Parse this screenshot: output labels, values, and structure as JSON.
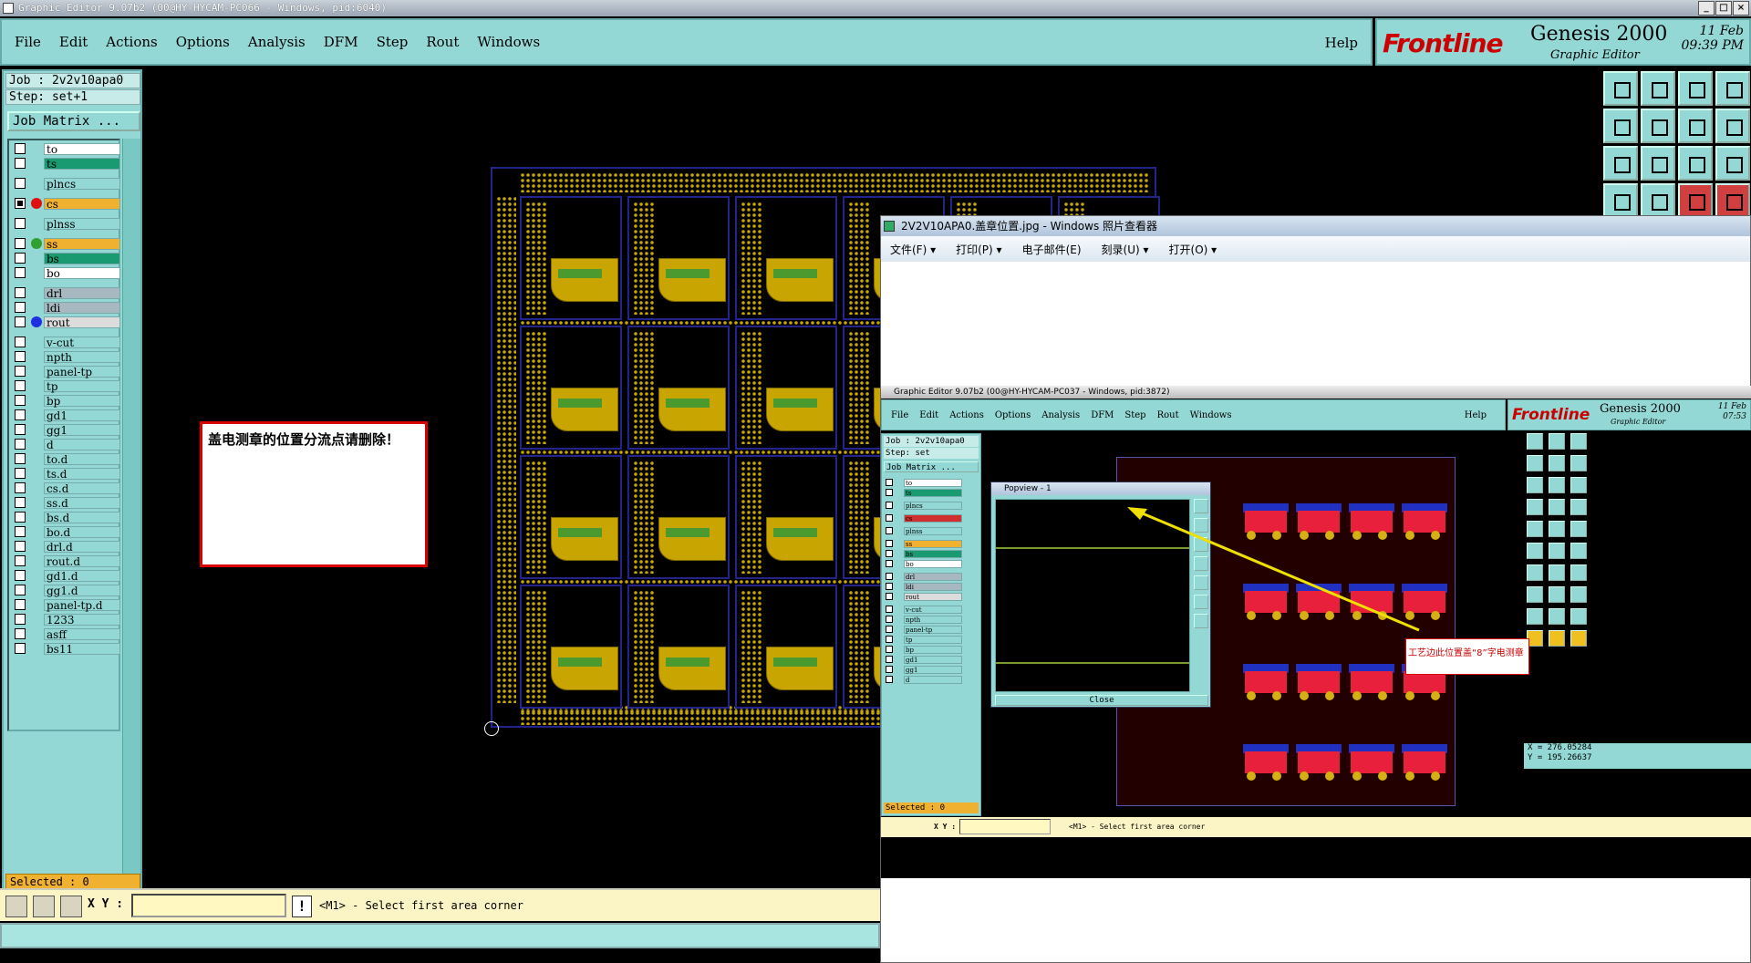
{
  "window": {
    "title": "Graphic Editor 9.07b2 (00@HY-HYCAM-PC066 - Windows, pid:6040)"
  },
  "menu": [
    "File",
    "Edit",
    "Actions",
    "Options",
    "Analysis",
    "DFM",
    "Step",
    "Rout",
    "Windows"
  ],
  "help_label": "Help",
  "brand": {
    "logo": "Frontline",
    "product": "Genesis 2000",
    "subtitle": "Graphic Editor",
    "date": "11 Feb",
    "time": "09:39 PM"
  },
  "job": {
    "job_line": "Job : 2v2v10apa0",
    "step_line": "Step: set+1",
    "matrix_button": "Job Matrix ..."
  },
  "layers": [
    {
      "name": "to",
      "color": "#ffffff",
      "dot": ""
    },
    {
      "name": "ts",
      "color": "#1a9a70",
      "dot": ""
    },
    {
      "name": "plncs",
      "color": "#93d8d4",
      "dot": ""
    },
    {
      "name": "cs",
      "color": "#f0b030",
      "dot": "#e01010"
    },
    {
      "name": "plnss",
      "color": "#93d8d4",
      "dot": ""
    },
    {
      "name": "ss",
      "color": "#f0b030",
      "dot": "#30a030"
    },
    {
      "name": "bs",
      "color": "#1a9a70",
      "dot": ""
    },
    {
      "name": "bo",
      "color": "#ffffff",
      "dot": ""
    },
    {
      "name": "drl",
      "color": "#a8b8c0",
      "dot": ""
    },
    {
      "name": "ldi",
      "color": "#a8b8c0",
      "dot": ""
    },
    {
      "name": "rout",
      "color": "#dcdcdc",
      "dot": "#2030e0"
    },
    {
      "name": "v-cut",
      "color": "#93d8d4",
      "dot": ""
    },
    {
      "name": "npth",
      "color": "#93d8d4",
      "dot": ""
    },
    {
      "name": "panel-tp",
      "color": "#93d8d4",
      "dot": ""
    },
    {
      "name": "tp",
      "color": "#93d8d4",
      "dot": ""
    },
    {
      "name": "bp",
      "color": "#93d8d4",
      "dot": ""
    },
    {
      "name": "gd1",
      "color": "#93d8d4",
      "dot": ""
    },
    {
      "name": "gg1",
      "color": "#93d8d4",
      "dot": ""
    },
    {
      "name": "d",
      "color": "#93d8d4",
      "dot": ""
    },
    {
      "name": "to.d",
      "color": "#93d8d4",
      "dot": ""
    },
    {
      "name": "ts.d",
      "color": "#93d8d4",
      "dot": ""
    },
    {
      "name": "cs.d",
      "color": "#93d8d4",
      "dot": ""
    },
    {
      "name": "ss.d",
      "color": "#93d8d4",
      "dot": ""
    },
    {
      "name": "bs.d",
      "color": "#93d8d4",
      "dot": ""
    },
    {
      "name": "bo.d",
      "color": "#93d8d4",
      "dot": ""
    },
    {
      "name": "drl.d",
      "color": "#93d8d4",
      "dot": ""
    },
    {
      "name": "rout.d",
      "color": "#93d8d4",
      "dot": ""
    },
    {
      "name": "gd1.d",
      "color": "#93d8d4",
      "dot": ""
    },
    {
      "name": "gg1.d",
      "color": "#93d8d4",
      "dot": ""
    },
    {
      "name": "panel-tp.d",
      "color": "#93d8d4",
      "dot": ""
    },
    {
      "name": "1233",
      "color": "#93d8d4",
      "dot": ""
    },
    {
      "name": "asff",
      "color": "#93d8d4",
      "dot": ""
    },
    {
      "name": "bs11",
      "color": "#93d8d4",
      "dot": ""
    }
  ],
  "selected_label": "Selected : 0",
  "note_text": "盖电测章的位置分流点请删除！",
  "bottom": {
    "xy_label": "X Y :",
    "status": "<M1> - Select first area corner"
  },
  "viewer": {
    "title": "2V2V10APA0.盖章位置.jpg - Windows 照片查看器",
    "menu": [
      "文件(F) ▾",
      "打印(P) ▾",
      "电子邮件(E)",
      "刻录(U) ▾",
      "打开(O) ▾"
    ]
  },
  "inner": {
    "title": "Graphic Editor 9.07b2 (00@HY-HYCAM-PC037 - Windows, pid:3872)",
    "menu": [
      "File",
      "Edit",
      "Actions",
      "Options",
      "Analysis",
      "DFM",
      "Step",
      "Rout",
      "Windows"
    ],
    "help": "Help",
    "brand_logo": "Frontline",
    "brand_product": "Genesis 2000",
    "brand_sub": "Graphic Editor",
    "date": "11 Feb",
    "time": "07:53",
    "job_line": "Job : 2v2v10apa0",
    "step_line": "Step: set",
    "matrix_button": "Job Matrix ...",
    "layers": [
      "to",
      "ts",
      "plncs",
      "cs",
      "plnss",
      "ss",
      "bs",
      "bo",
      "drl",
      "ldi",
      "rout",
      "v-cut",
      "npth",
      "panel-tp",
      "tp",
      "bp",
      "gd1",
      "gg1",
      "d"
    ],
    "selected": "Selected : 0",
    "popview_title": "Popview - 1",
    "close_label": "Close",
    "annotation": "工艺边此位置盖“8”字电测章",
    "coord_x": "X = 276.05284",
    "coord_y": "Y = 195.26637",
    "xy_label": "X Y :",
    "status": "<M1> - Select first area corner"
  }
}
